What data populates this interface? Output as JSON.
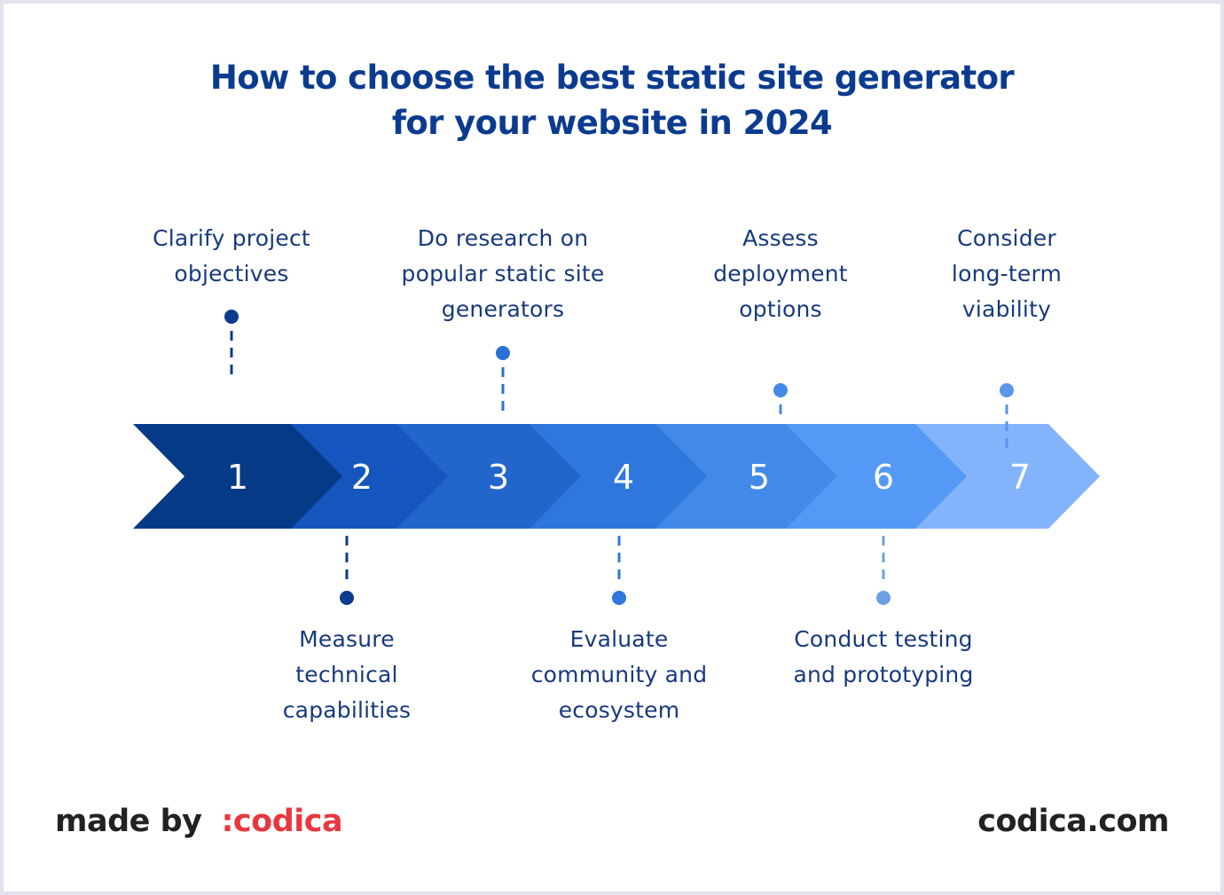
{
  "title": {
    "line1": "How to choose the best static site generator",
    "line2": "for your website in 2024"
  },
  "steps": [
    {
      "number": "1",
      "label": [
        "Clarify project",
        "objectives"
      ],
      "position": "top",
      "color": "#053a86"
    },
    {
      "number": "2",
      "label": [
        "Measure",
        "technical",
        "capabilities"
      ],
      "position": "bottom",
      "color": "#1556be"
    },
    {
      "number": "3",
      "label": [
        "Do research on",
        "popular static site",
        "generators"
      ],
      "position": "top",
      "color": "#2266cc"
    },
    {
      "number": "4",
      "label": [
        "Evaluate",
        "community and",
        "ecosystem"
      ],
      "position": "bottom",
      "color": "#2f77dc"
    },
    {
      "number": "5",
      "label": [
        "Assess",
        "deployment",
        "options"
      ],
      "position": "top",
      "color": "#438ae8"
    },
    {
      "number": "6",
      "label": [
        "Conduct testing",
        "and prototyping"
      ],
      "position": "bottom",
      "color": "#5499f5"
    },
    {
      "number": "7",
      "label": [
        "Consider",
        "long-term",
        "viability"
      ],
      "position": "top",
      "color": "#83b4fb"
    }
  ],
  "connector_colors": [
    "#0b3b8f",
    "#0b3b8f",
    "#2c6fd3",
    "#2f77dc",
    "#438ae8",
    "#6f9fe4",
    "#5a96ea"
  ],
  "footer": {
    "made_by": "made by",
    "brand": ":codica",
    "website": "codica.com"
  },
  "colors": {
    "title": "#0b3b8f",
    "label": "#173a7c",
    "brand": "#e8373e",
    "footer_text": "#222222"
  }
}
